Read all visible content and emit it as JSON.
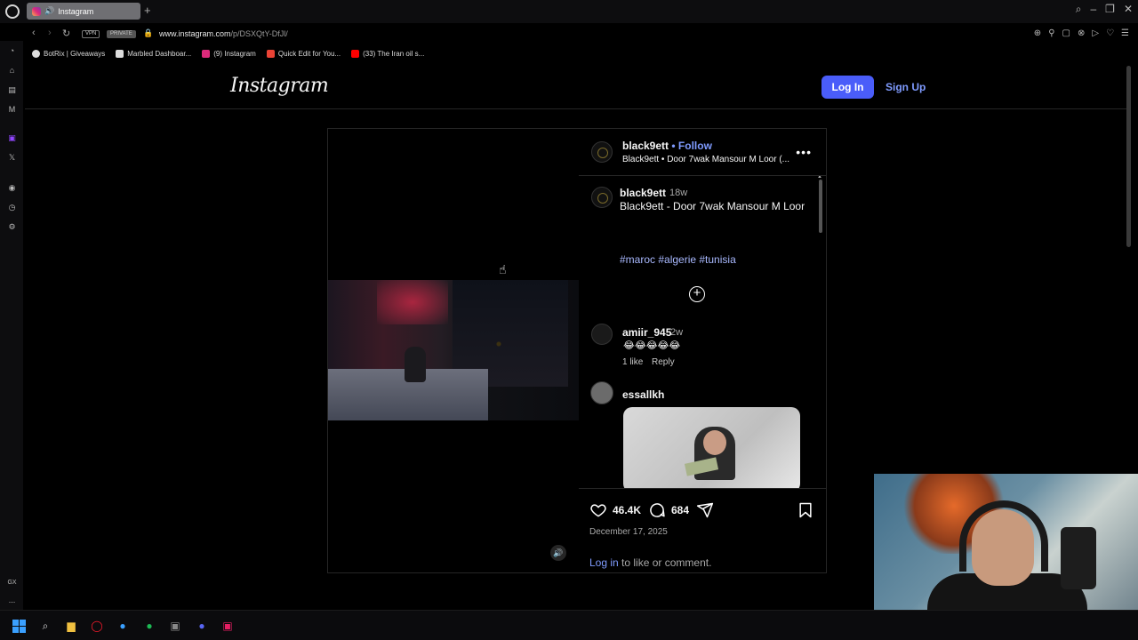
{
  "browser": {
    "tab_title": "Instagram",
    "new_tab": "+",
    "badges": {
      "vpn": "VPN",
      "private": "PRIVATE"
    },
    "url_host": "www.instagram.com",
    "url_path": "/p/DSXQtY-DfJl/",
    "sidebar_label_gx": "GX",
    "sidebar_label_more": "..."
  },
  "bookmarks": [
    {
      "label": "BotRix | Giveaways",
      "color": "#dddddd"
    },
    {
      "label": "Marbled Dashboar...",
      "color": "#dddddd"
    },
    {
      "label": "(9) Instagram",
      "color": "#dd2a7b"
    },
    {
      "label": "Quick Edit for You...",
      "color": "#ea4335"
    },
    {
      "label": "(33) The Iran oil s...",
      "color": "#ff0000"
    }
  ],
  "header": {
    "logo": "Instagram",
    "login_label": "Log In",
    "signup_label": "Sign Up"
  },
  "post": {
    "author": "black9ett",
    "follow_label": "• Follow",
    "subtitle": "Black9ett • Door 7wak Mansour M Loor (...",
    "caption_author": "black9ett",
    "caption_age": "18w",
    "caption_text": "Black9ett - Door 7wak Mansour M Loor",
    "hashtags": "#maroc #algerie #tunisia",
    "comments": [
      {
        "user": "amiir_945",
        "age": "2w",
        "text": "😂😂😂😂😂",
        "likes": "1 like",
        "reply": "Reply"
      },
      {
        "user": "essallkh"
      }
    ],
    "like_count": "46.4K",
    "comment_count": "684",
    "date": "December 17, 2025",
    "login_link": "Log in",
    "login_suffix": " to like or comment."
  },
  "colors": {
    "accent_blue": "#4a5df9",
    "link_blue": "#7f9bff",
    "background": "#000000"
  }
}
